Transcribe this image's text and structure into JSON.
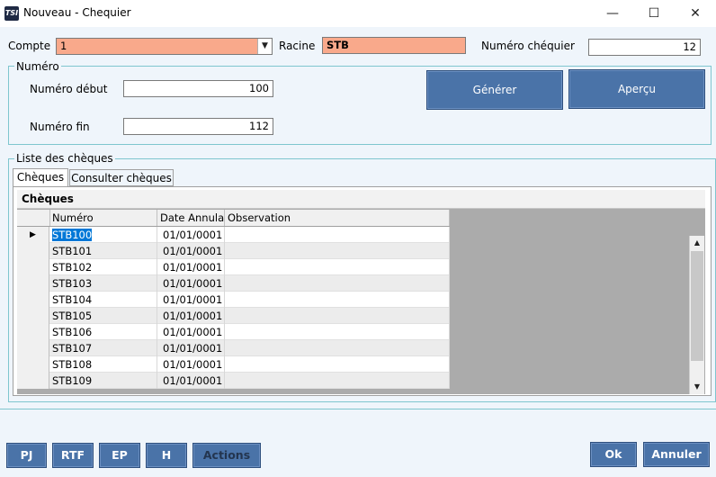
{
  "window": {
    "app_icon_text": "TSI",
    "title": "Nouveau - Chequier",
    "minimize": "—",
    "maximize": "☐",
    "close": "✕"
  },
  "form": {
    "compte_label": "Compte",
    "compte_value": "1",
    "racine_label": "Racine",
    "racine_value": "STB",
    "numero_chequier_label": "Numéro chéquier",
    "numero_chequier_value": "12"
  },
  "numero_group": {
    "title": "Numéro",
    "debut_label": "Numéro début",
    "debut_value": "100",
    "fin_label": "Numéro fin",
    "fin_value": "112"
  },
  "actions_top": {
    "generer": "Générer",
    "apercu": "Aperçu"
  },
  "liste_group": {
    "title": "Liste des chèques",
    "tabs": [
      {
        "label": "Chèques"
      },
      {
        "label": "Consulter chèques"
      }
    ],
    "grid_title": "Chèques",
    "columns": [
      "Numéro",
      "Date Annula",
      "Observation"
    ],
    "rows": [
      {
        "numero": "STB100",
        "date": "01/01/0001",
        "observation": ""
      },
      {
        "numero": "STB101",
        "date": "01/01/0001",
        "observation": ""
      },
      {
        "numero": "STB102",
        "date": "01/01/0001",
        "observation": ""
      },
      {
        "numero": "STB103",
        "date": "01/01/0001",
        "observation": ""
      },
      {
        "numero": "STB104",
        "date": "01/01/0001",
        "observation": ""
      },
      {
        "numero": "STB105",
        "date": "01/01/0001",
        "observation": ""
      },
      {
        "numero": "STB106",
        "date": "01/01/0001",
        "observation": ""
      },
      {
        "numero": "STB107",
        "date": "01/01/0001",
        "observation": ""
      },
      {
        "numero": "STB108",
        "date": "01/01/0001",
        "observation": ""
      },
      {
        "numero": "STB109",
        "date": "01/01/0001",
        "observation": ""
      }
    ]
  },
  "bottom_bar": {
    "pj": "PJ",
    "rtf": "RTF",
    "ep": "EP",
    "h": "H",
    "actions": "Actions",
    "ok": "Ok",
    "annuler": "Annuler"
  },
  "colors": {
    "accent_button": "#4a73a8",
    "highlight_field": "#f9a98b",
    "selection": "#0078d7"
  }
}
